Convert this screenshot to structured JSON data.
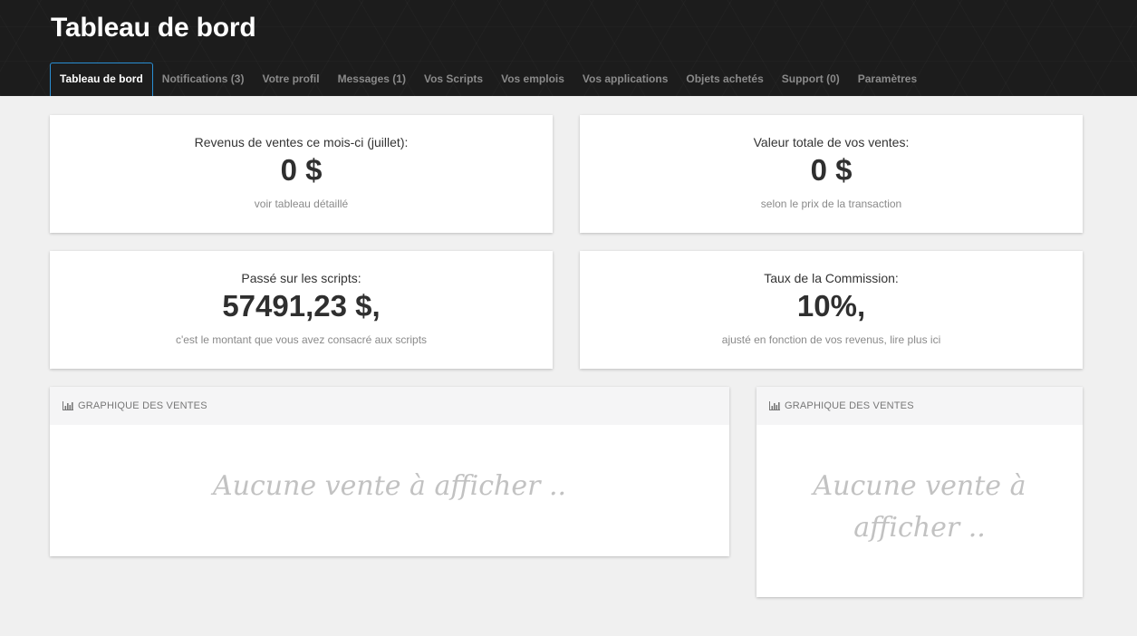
{
  "header": {
    "title": "Tableau de bord",
    "tabs": [
      {
        "label": "Tableau de bord",
        "active": true
      },
      {
        "label": "Notifications (3)"
      },
      {
        "label": "Votre profil"
      },
      {
        "label": "Messages (1)"
      },
      {
        "label": "Vos Scripts"
      },
      {
        "label": "Vos emplois"
      },
      {
        "label": "Vos applications"
      },
      {
        "label": "Objets achetés"
      },
      {
        "label": "Support (0)"
      },
      {
        "label": "Paramètres"
      }
    ]
  },
  "stats": {
    "revenue": {
      "label": "Revenus de ventes ce mois-ci (juillet):",
      "value": "0 $",
      "note": "voir tableau détaillé"
    },
    "total_sales": {
      "label": "Valeur totale de vos ventes:",
      "value": "0 $",
      "note": "selon le prix de la transaction"
    },
    "spent": {
      "label": "Passé sur les scripts:",
      "value": "57491,23 $,",
      "note": "c'est le montant que vous avez consacré aux scripts"
    },
    "commission": {
      "label": "Taux de la Commission:",
      "value": "10%,",
      "note": "ajusté en fonction de vos revenus, lire plus ici"
    }
  },
  "charts": {
    "main": {
      "title": "GRAPHIQUE DES VENTES",
      "empty": "Aucune vente à afficher .."
    },
    "side": {
      "title": "GRAPHIQUE DES VENTES",
      "empty_line1": "Aucune vente à",
      "empty_line2": "afficher .."
    }
  },
  "icons": {
    "chart": "bar-chart-icon"
  },
  "colors": {
    "active_tab_border": "#2a8fd4",
    "header_bg": "#1c1c1c",
    "page_bg": "#f0f0f0"
  }
}
